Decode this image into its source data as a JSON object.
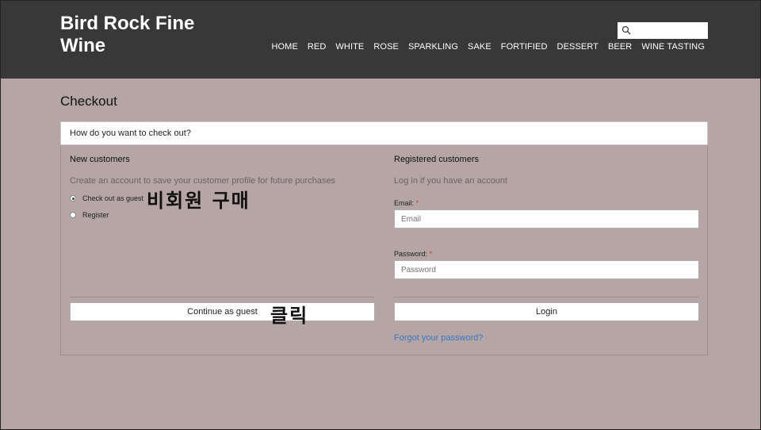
{
  "site": {
    "logo": "Bird Rock Fine Wine"
  },
  "nav": [
    "HOME",
    "RED",
    "WHITE",
    "ROSE",
    "SPARKLING",
    "SAKE",
    "FORTIFIED",
    "DESSERT",
    "BEER",
    "WINE TASTING"
  ],
  "search": {
    "placeholder": ""
  },
  "page": {
    "title": "Checkout",
    "question": "How do you want to check out?"
  },
  "new_customers": {
    "title": "New customers",
    "subtitle": "Create an account to save your customer profile for future purchases",
    "option_guest": "Check out as guest",
    "option_register": "Register",
    "continue_label": "Continue as guest"
  },
  "registered": {
    "title": "Registered customers",
    "subtitle": "Log in if you have an account",
    "email_label": "Email:",
    "email_placeholder": "Email",
    "password_label": "Password:",
    "password_placeholder": "Password",
    "required_mark": "*",
    "login_label": "Login",
    "forgot_label": "Forgot your password?"
  },
  "annotations": {
    "guest_buy": "비회원 구매",
    "click": "클릭"
  }
}
